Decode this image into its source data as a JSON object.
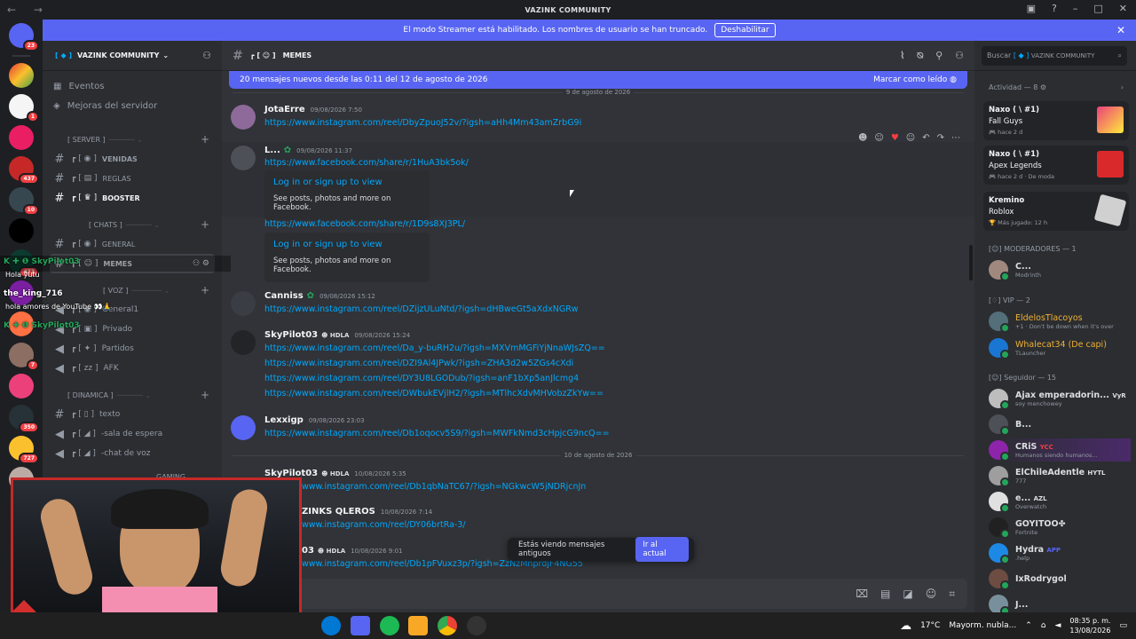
{
  "window": {
    "title": "VAZINK COMMUNITY",
    "nav": "← →"
  },
  "banner": {
    "text": "El modo Streamer está habilitado. Los nombres de usuario se han truncado.",
    "button": "Deshabilitar"
  },
  "servers": {
    "badges": [
      "23",
      "1",
      "437",
      "10",
      "473",
      "7",
      "350",
      "727"
    ]
  },
  "guild": {
    "name": "VAZINK COMMUNITY"
  },
  "sidebar": {
    "top": [
      "Eventos",
      "Mejoras del servidor"
    ],
    "cat_server": "[ SERVER ]",
    "ch_server": [
      "VENIDAS",
      "REGLAS",
      "BOOSTER"
    ],
    "cat_chats": "[ CHATS ]",
    "ch_chats": [
      "GENERAL",
      "MEMES"
    ],
    "cat_voz": "[ VOZ ]",
    "ch_voz": [
      "General1",
      "Privado",
      "Partidos",
      "AFK"
    ],
    "cat_dinamica": "[ DINAMICA ]",
    "ch_dinamica": [
      "texto",
      "-sala de espera",
      "-chat de voz"
    ],
    "cat_gaming": "GAMING"
  },
  "overlay": {
    "rows": [
      {
        "user": "SkyPilot03",
        "msg": "Hola yutu"
      },
      {
        "user": "the_king_716",
        "msg": "hola amores de YouTube"
      },
      {
        "user": "SkyPilot03",
        "msg": ""
      }
    ]
  },
  "chat": {
    "channel": "MEMES",
    "newbar": {
      "text": "20 mensajes nuevos desde las 0:11 del 12 de agosto de 2026",
      "action": "Marcar como leído"
    },
    "date1": "9 de agosto de 2026",
    "date2": "10 de agosto de 2026",
    "messages": [
      {
        "user": "JotaErre",
        "ts": "09/08/2026 7:50",
        "links": [
          "https://www.instagram.com/reel/DbyZpuoJ52v/?igsh=aHh4Mm43amZrbG9i"
        ]
      },
      {
        "user": "L...",
        "ts": "09/08/2026 11:37",
        "links": [
          "https://www.facebook.com/share/r/1HuA3bk5ok/",
          "https://www.facebook.com/share/r/1D9s8XJ3PL/"
        ],
        "embed_title": "Log in or sign up to view",
        "embed_desc": "See posts, photos and more on Facebook."
      },
      {
        "user": "Canniss",
        "ts": "09/08/2026 15:12",
        "links": [
          "https://www.instagram.com/reel/DZijzULuNtd/?igsh=dHBweGt5aXdxNGRw"
        ]
      },
      {
        "user": "SkyPilot03",
        "tag": "HDLA",
        "ts": "09/08/2026 15:24",
        "links": [
          "https://www.instagram.com/reel/Da_y-buRH2u/?igsh=MXVmMGFiYjNnaWJsZQ==",
          "https://www.instagram.com/reel/DZI9Al4JPwk/?igsh=ZHA3d2w5ZGs4cXdi",
          "https://www.instagram.com/reel/DY3U8LGODub/?igsh=anF1bXp5anJlcmg4",
          "https://www.instagram.com/reel/DWbukEVjlH2/?igsh=MTlhcXdvMHVobzZkYw=="
        ]
      },
      {
        "user": "Lexxigp",
        "ts": "09/08/2026 23:03",
        "links": [
          "https://www.instagram.com/reel/Db1oqocv5S9/?igsh=MWFkNmd3cHpjcG9ncQ=="
        ]
      },
      {
        "user": "SkyPilot03",
        "tag": "HDLA",
        "ts": "10/08/2026 5:35",
        "links": [
          "www.instagram.com/reel/Db1qbNaTC67/?igsh=NGkwcW5jNDRjcnJn"
        ]
      },
      {
        "user": "ZINKS QLEROS",
        "ts": "10/08/2026 7:14",
        "links": [
          "www.instagram.com/reel/DY06brtRa-3/"
        ]
      },
      {
        "user": "03",
        "tag": "HDLA",
        "ts": "10/08/2026 9:01",
        "links": [
          "www.instagram.com/reel/Db1pFVuxz3p/?igsh=ZzNzMnprdjF4NG55"
        ]
      }
    ],
    "toast": {
      "text": "Estás viendo mensajes antiguos",
      "button": "Ir al actual"
    }
  },
  "members": {
    "search_label": "Buscar",
    "search_server": "VAZINK COMMUNITY",
    "activity_header": "Actividad — 8",
    "activities": [
      {
        "name": "Naxo ( \\ #1)",
        "game": "Fall Guys",
        "status": "hace 2 d"
      },
      {
        "name": "Naxo ( \\ #1)",
        "game": "Apex Legends",
        "status": "hace 2 d · De moda"
      },
      {
        "name": "Kremino",
        "game": "Roblox",
        "status": "Más jugado: 12 h"
      }
    ],
    "mods_header": "MODERADORES — 1",
    "mods": [
      {
        "name": "C...",
        "sub": "Modrinth"
      }
    ],
    "vip_header": "VIP — 2",
    "vip": [
      {
        "name": "EldelosTlacoyos",
        "sub": "+1 · Don't be down when it's over"
      },
      {
        "name": "Whalecat34 (De capi)",
        "sub": "TLauncher"
      }
    ],
    "follow_header": "Seguidor — 15",
    "follow": [
      {
        "name": "Ajax emperadorin...",
        "tag": "VyR",
        "sub": "soy menchowey"
      },
      {
        "name": "B...",
        "tag": "",
        "sub": ""
      },
      {
        "name": "CRiS",
        "tag": "YCC",
        "sub": "Humanos siendo humanos..."
      },
      {
        "name": "ElChileAdentle",
        "tag": "HYTL",
        "sub": "777"
      },
      {
        "name": "e...",
        "tag": "AZL",
        "sub": "Overwatch"
      },
      {
        "name": "GOYITOO✤",
        "tag": "",
        "sub": "Fortnite"
      },
      {
        "name": "Hydra",
        "tag": "APP",
        "sub": ".help"
      },
      {
        "name": "IxRodrygol",
        "tag": "",
        "sub": ""
      },
      {
        "name": "J...",
        "tag": "",
        "sub": ""
      }
    ]
  },
  "taskbar": {
    "weather": "17°C",
    "weather_desc": "Mayorm. nubla...",
    "time": "08:35 p. m.",
    "date": "13/08/2026"
  }
}
